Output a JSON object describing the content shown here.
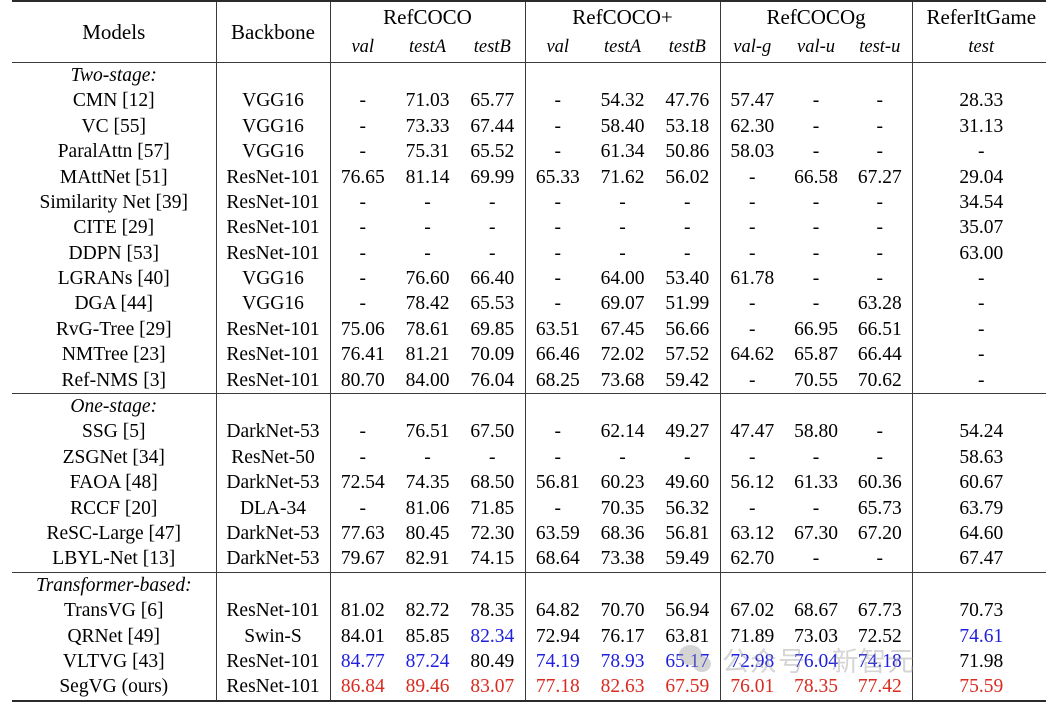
{
  "table": {
    "column_groups": [
      {
        "label": "Models",
        "span": 1
      },
      {
        "label": "Backbone",
        "span": 1
      },
      {
        "label": "RefCOCO",
        "span": 3
      },
      {
        "label": "RefCOCO+",
        "span": 3
      },
      {
        "label": "RefCOCOg",
        "span": 3
      },
      {
        "label": "ReferItGame",
        "span": 1
      }
    ],
    "subheaders": [
      "val",
      "testA",
      "testB",
      "val",
      "testA",
      "testB",
      "val-g",
      "val-u",
      "test-u",
      "test"
    ],
    "sections": [
      {
        "label": "Two-stage:",
        "rows": [
          {
            "model": "CMN [12]",
            "backbone": "VGG16",
            "values": [
              "-",
              "71.03",
              "65.77",
              "-",
              "54.32",
              "47.76",
              "57.47",
              "-",
              "-",
              "28.33"
            ]
          },
          {
            "model": "VC [55]",
            "backbone": "VGG16",
            "values": [
              "-",
              "73.33",
              "67.44",
              "-",
              "58.40",
              "53.18",
              "62.30",
              "-",
              "-",
              "31.13"
            ]
          },
          {
            "model": "ParalAttn [57]",
            "backbone": "VGG16",
            "values": [
              "-",
              "75.31",
              "65.52",
              "-",
              "61.34",
              "50.86",
              "58.03",
              "-",
              "-",
              "-"
            ]
          },
          {
            "model": "MAttNet [51]",
            "backbone": "ResNet-101",
            "values": [
              "76.65",
              "81.14",
              "69.99",
              "65.33",
              "71.62",
              "56.02",
              "-",
              "66.58",
              "67.27",
              "29.04"
            ]
          },
          {
            "model": "Similarity Net [39]",
            "backbone": "ResNet-101",
            "values": [
              "-",
              "-",
              "-",
              "-",
              "-",
              "-",
              "-",
              "-",
              "-",
              "34.54"
            ]
          },
          {
            "model": "CITE [29]",
            "backbone": "ResNet-101",
            "values": [
              "-",
              "-",
              "-",
              "-",
              "-",
              "-",
              "-",
              "-",
              "-",
              "35.07"
            ]
          },
          {
            "model": "DDPN [53]",
            "backbone": "ResNet-101",
            "values": [
              "-",
              "-",
              "-",
              "-",
              "-",
              "-",
              "-",
              "-",
              "-",
              "63.00"
            ]
          },
          {
            "model": "LGRANs [40]",
            "backbone": "VGG16",
            "values": [
              "-",
              "76.60",
              "66.40",
              "-",
              "64.00",
              "53.40",
              "61.78",
              "-",
              "-",
              "-"
            ]
          },
          {
            "model": "DGA [44]",
            "backbone": "VGG16",
            "values": [
              "-",
              "78.42",
              "65.53",
              "-",
              "69.07",
              "51.99",
              "-",
              "-",
              "63.28",
              "-"
            ]
          },
          {
            "model": "RvG-Tree [29]",
            "backbone": "ResNet-101",
            "values": [
              "75.06",
              "78.61",
              "69.85",
              "63.51",
              "67.45",
              "56.66",
              "-",
              "66.95",
              "66.51",
              "-"
            ]
          },
          {
            "model": "NMTree [23]",
            "backbone": "ResNet-101",
            "values": [
              "76.41",
              "81.21",
              "70.09",
              "66.46",
              "72.02",
              "57.52",
              "64.62",
              "65.87",
              "66.44",
              "-"
            ]
          },
          {
            "model": "Ref-NMS [3]",
            "backbone": "ResNet-101",
            "values": [
              "80.70",
              "84.00",
              "76.04",
              "68.25",
              "73.68",
              "59.42",
              "-",
              "70.55",
              "70.62",
              "-"
            ]
          }
        ]
      },
      {
        "label": "One-stage:",
        "rows": [
          {
            "model": "SSG [5]",
            "backbone": "DarkNet-53",
            "values": [
              "-",
              "76.51",
              "67.50",
              "-",
              "62.14",
              "49.27",
              "47.47",
              "58.80",
              "-",
              "54.24"
            ]
          },
          {
            "model": "ZSGNet [34]",
            "backbone": "ResNet-50",
            "values": [
              "-",
              "-",
              "-",
              "-",
              "-",
              "-",
              "-",
              "-",
              "-",
              "58.63"
            ]
          },
          {
            "model": "FAOA [48]",
            "backbone": "DarkNet-53",
            "values": [
              "72.54",
              "74.35",
              "68.50",
              "56.81",
              "60.23",
              "49.60",
              "56.12",
              "61.33",
              "60.36",
              "60.67"
            ]
          },
          {
            "model": "RCCF [20]",
            "backbone": "DLA-34",
            "values": [
              "-",
              "81.06",
              "71.85",
              "-",
              "70.35",
              "56.32",
              "-",
              "-",
              "65.73",
              "63.79"
            ]
          },
          {
            "model": "ReSC-Large [47]",
            "backbone": "DarkNet-53",
            "values": [
              "77.63",
              "80.45",
              "72.30",
              "63.59",
              "68.36",
              "56.81",
              "63.12",
              "67.30",
              "67.20",
              "64.60"
            ]
          },
          {
            "model": "LBYL-Net [13]",
            "backbone": "DarkNet-53",
            "values": [
              "79.67",
              "82.91",
              "74.15",
              "68.64",
              "73.38",
              "59.49",
              "62.70",
              "-",
              "-",
              "67.47"
            ]
          }
        ]
      },
      {
        "label": "Transformer-based:",
        "rows": [
          {
            "model": "TransVG [6]",
            "backbone": "ResNet-101",
            "values": [
              "81.02",
              "82.72",
              "78.35",
              "64.82",
              "70.70",
              "56.94",
              "67.02",
              "68.67",
              "67.73",
              "70.73"
            ],
            "styles": [
              "",
              "",
              "",
              "",
              "",
              "",
              "",
              "",
              "",
              ""
            ]
          },
          {
            "model": "QRNet [49]",
            "backbone": "Swin-S",
            "values": [
              "84.01",
              "85.85",
              "82.34",
              "72.94",
              "76.17",
              "63.81",
              "71.89",
              "73.03",
              "72.52",
              "74.61"
            ],
            "styles": [
              "",
              "",
              "blue",
              "",
              "",
              "",
              "",
              "",
              "",
              "blue"
            ]
          },
          {
            "model": "VLTVG [43]",
            "backbone": "ResNet-101",
            "values": [
              "84.77",
              "87.24",
              "80.49",
              "74.19",
              "78.93",
              "65.17",
              "72.98",
              "76.04",
              "74.18",
              "71.98"
            ],
            "styles": [
              "blue",
              "blue",
              "",
              "blue",
              "blue",
              "blue",
              "blue",
              "blue",
              "blue",
              ""
            ]
          },
          {
            "model": "SegVG (ours)",
            "backbone": "ResNet-101",
            "values": [
              "86.84",
              "89.46",
              "83.07",
              "77.18",
              "82.63",
              "67.59",
              "76.01",
              "78.35",
              "77.42",
              "75.59"
            ],
            "styles": [
              "red",
              "red",
              "red",
              "red",
              "red",
              "red",
              "red",
              "red",
              "red",
              "red"
            ]
          }
        ]
      }
    ]
  },
  "watermark": {
    "text": "公众号",
    "dot": "·",
    "text2": "新智元",
    "logo": "wechat-logo"
  },
  "colors": {
    "best": "#d92b20",
    "second": "#2020dd",
    "rule": "#2b2b2b"
  }
}
